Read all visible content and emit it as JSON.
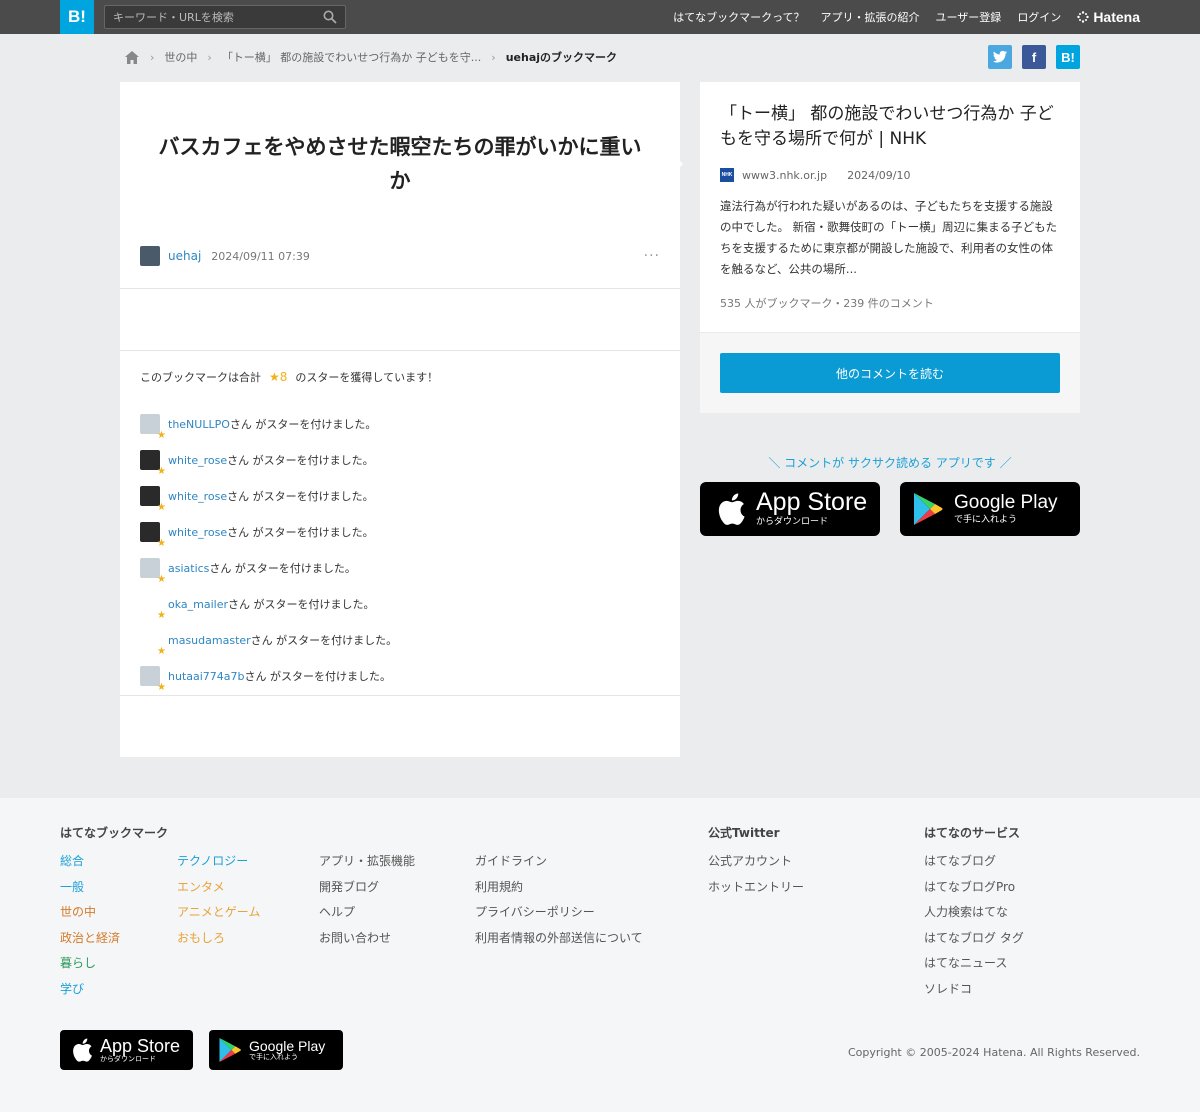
{
  "header": {
    "logo": "B!",
    "search_placeholder": "キーワード・URLを検索",
    "nav": [
      "はてなブックマークって？",
      "アプリ・拡張の紹介",
      "ユーザー登録",
      "ログイン"
    ],
    "brand": "Hatena"
  },
  "breadcrumb": {
    "items": [
      "世の中",
      "「トー横」 都の施設でわいせつ行為か 子どもを守...",
      "uehajのブックマーク"
    ]
  },
  "share": [
    "t",
    "f",
    "B!"
  ],
  "bookmark": {
    "title": "バスカフェをやめさせた暇空たちの罪がいかに重いか",
    "user": "uehaj",
    "date": "2024/09/11 07:39",
    "more": "···",
    "stars_prefix": "このブックマークは合計",
    "stars_count": "★8",
    "stars_suffix": "のスターを獲得しています！",
    "star_text": "さん がスターを付けました。",
    "stars": [
      {
        "user": "theNULLPO",
        "avatar": "#c8d0d8"
      },
      {
        "user": "white_rose",
        "avatar": "#2a2a2a"
      },
      {
        "user": "white_rose",
        "avatar": "#2a2a2a"
      },
      {
        "user": "white_rose",
        "avatar": "#2a2a2a"
      },
      {
        "user": "asiatics",
        "avatar": "#c8d0d8"
      },
      {
        "user": "oka_mailer",
        "avatar": "#ffffff"
      },
      {
        "user": "masudamaster",
        "avatar": "#ffffff"
      },
      {
        "user": "hutaai774a7b",
        "avatar": "#c8d0d8"
      }
    ]
  },
  "entry": {
    "title": "「トー横」 都の施設でわいせつ行為か 子どもを守る場所で何が | NHK",
    "site_icon": "NHK",
    "domain": "www3.nhk.or.jp",
    "date": "2024/09/10",
    "description": "違法行為が行われた疑いがあるのは、子どもたちを支援する施設の中でした。 新宿・歌舞伎町の「トー横」周辺に集まる子どもたちを支援するために東京都が開設した施設で、利用者の女性の体を触るなど、公共の場所...",
    "counts": "535 人がブックマーク・239 件のコメント",
    "read_button": "他のコメントを読む"
  },
  "promo": {
    "text": "＼ コメントが サクサク読める アプリです ／",
    "app_store_big": "App Store",
    "app_store_small": "からダウンロード",
    "google_play_big": "Google Play",
    "google_play_small": "で手に入れよう"
  },
  "footer": {
    "bookmark_head": "はてなブックマーク",
    "categories_1": [
      {
        "label": "総合",
        "color": "#1aa0d6"
      },
      {
        "label": "一般",
        "color": "#1aa0d6"
      },
      {
        "label": "世の中",
        "color": "#d47b2a"
      },
      {
        "label": "政治と経済",
        "color": "#d47b2a"
      },
      {
        "label": "暮らし",
        "color": "#2a9a5a"
      },
      {
        "label": "学び",
        "color": "#1aa0d6"
      }
    ],
    "categories_2": [
      {
        "label": "テクノロジー",
        "color": "#1aa0d6"
      },
      {
        "label": "エンタメ",
        "color": "#e8a33a"
      },
      {
        "label": "アニメとゲーム",
        "color": "#e8a33a"
      },
      {
        "label": "おもしろ",
        "color": "#e8a33a"
      }
    ],
    "links_1": [
      "アプリ・拡張機能",
      "開発ブログ",
      "ヘルプ",
      "お問い合わせ"
    ],
    "links_2": [
      "ガイドライン",
      "利用規約",
      "プライバシーポリシー",
      "利用者情報の外部送信について"
    ],
    "twitter_head": "公式Twitter",
    "twitter_links": [
      "公式アカウント",
      "ホットエントリー"
    ],
    "services_head": "はてなのサービス",
    "services": [
      "はてなブログ",
      "はてなブログPro",
      "人力検索はてな",
      "はてなブログ タグ",
      "はてなニュース",
      "ソレドコ"
    ],
    "copyright": "Copyright © 2005-2024 Hatena. All Rights Reserved."
  }
}
